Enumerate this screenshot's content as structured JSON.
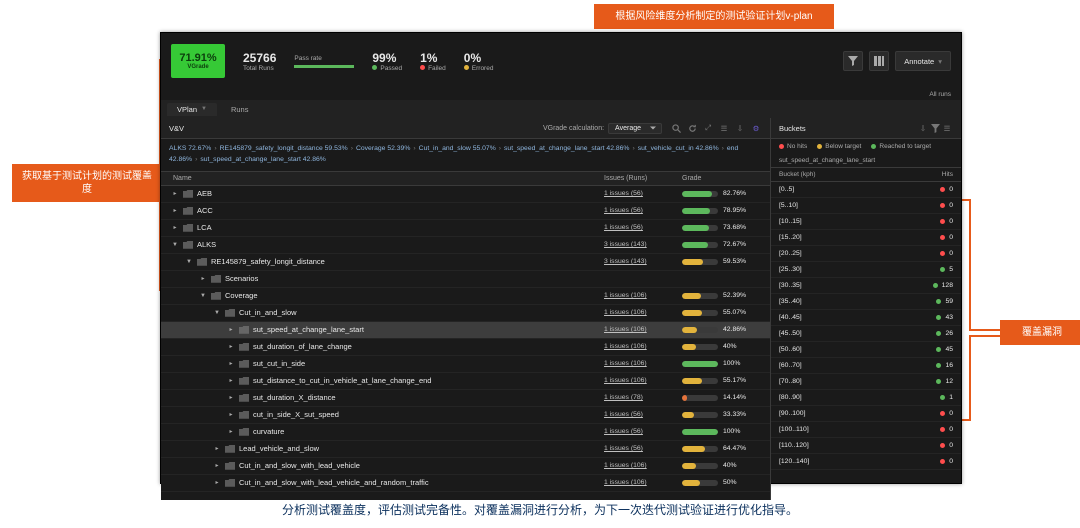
{
  "colors": {
    "green": "#5cb85c",
    "yellow": "#e2b33c",
    "orange": "#e6743c",
    "red": "#ff4d4d"
  },
  "callouts": {
    "top": "根据风险维度分析制定的测试验证计划v-plan",
    "left": "获取基于测试计划的测试覆盖度",
    "right": "覆盖漏洞"
  },
  "kpi": {
    "vgrade_value": "71.91%",
    "vgrade_label": "VGrade",
    "total_runs": "25766",
    "total_runs_label": "Total Runs",
    "pass_rate_label": "Pass rate",
    "passed_pct": "99%",
    "passed_label": "Passed",
    "failed_pct": "1%",
    "failed_label": "Failed",
    "errored_pct": "0%",
    "errored_label": "Errored",
    "annotate_label": "Annotate",
    "all_runs_label": "All runs"
  },
  "tabs": {
    "vplan": "VPlan",
    "runs": "Runs"
  },
  "vv": {
    "title": "V&V",
    "calc_label": "VGrade calculation:",
    "calc_value": "Average",
    "breadcrumbs": [
      "ALKS 72.67%",
      "RE145879_safety_longit_distance 59.53%",
      "Coverage 52.39%",
      "Cut_in_and_slow 55.07%",
      "sut_speed_at_change_lane_start 42.86%",
      "sut_vehicle_cut_in 42.86%",
      "end 42.86%",
      "sut_speed_at_change_lane_start 42.86%"
    ],
    "cols": {
      "name": "Name",
      "issues": "Issues (Runs)",
      "grade": "Grade"
    },
    "rows": [
      {
        "indent": 0,
        "caret": "right",
        "label": "AEB",
        "issues": "1 issues (56)",
        "pct": 82.76,
        "sel": false,
        "color": "green"
      },
      {
        "indent": 0,
        "caret": "right",
        "label": "ACC",
        "issues": "1 issues (56)",
        "pct": 78.95,
        "sel": false,
        "color": "green"
      },
      {
        "indent": 0,
        "caret": "right",
        "label": "LCA",
        "issues": "1 issues (56)",
        "pct": 73.68,
        "sel": false,
        "color": "green"
      },
      {
        "indent": 0,
        "caret": "down",
        "label": "ALKS",
        "issues": "3 issues (143)",
        "pct": 72.67,
        "sel": false,
        "color": "green"
      },
      {
        "indent": 1,
        "caret": "down",
        "label": "RE145879_safety_longit_distance",
        "issues": "3 issues (143)",
        "pct": 59.53,
        "sel": false,
        "color": "yellow"
      },
      {
        "indent": 2,
        "caret": "right",
        "label": "Scenarios",
        "issues": "",
        "pct": null,
        "sel": false
      },
      {
        "indent": 2,
        "caret": "down",
        "label": "Coverage",
        "issues": "1 issues (106)",
        "pct": 52.39,
        "sel": false,
        "color": "yellow"
      },
      {
        "indent": 3,
        "caret": "down",
        "label": "Cut_in_and_slow",
        "issues": "1 issues (106)",
        "pct": 55.07,
        "sel": false,
        "color": "yellow"
      },
      {
        "indent": 4,
        "caret": "right",
        "label": "sut_speed_at_change_lane_start",
        "issues": "1 issues (106)",
        "pct": 42.86,
        "sel": true,
        "color": "yellow"
      },
      {
        "indent": 4,
        "caret": "right",
        "label": "sut_duration_of_lane_change",
        "issues": "1 issues (106)",
        "pct": 40,
        "sel": false,
        "color": "yellow"
      },
      {
        "indent": 4,
        "caret": "right",
        "label": "sut_cut_in_side",
        "issues": "1 issues (106)",
        "pct": 100,
        "sel": false,
        "color": "green"
      },
      {
        "indent": 4,
        "caret": "right",
        "label": "sut_distance_to_cut_in_vehicle_at_lane_change_end",
        "issues": "1 issues (106)",
        "pct": 55.17,
        "sel": false,
        "color": "yellow"
      },
      {
        "indent": 4,
        "caret": "right",
        "label": "sut_duration_X_distance",
        "issues": "1 issues (78)",
        "pct": 14.14,
        "sel": false,
        "color": "orange"
      },
      {
        "indent": 4,
        "caret": "right",
        "label": "cut_in_side_X_sut_speed",
        "issues": "1 issues (56)",
        "pct": 33.33,
        "sel": false,
        "color": "yellow"
      },
      {
        "indent": 4,
        "caret": "right",
        "label": "curvature",
        "issues": "1 issues (56)",
        "pct": 100,
        "sel": false,
        "color": "green"
      },
      {
        "indent": 3,
        "caret": "right",
        "label": "Lead_vehicle_and_slow",
        "issues": "1 issues (56)",
        "pct": 64.47,
        "sel": false,
        "color": "yellow"
      },
      {
        "indent": 3,
        "caret": "right",
        "label": "Cut_in_and_slow_with_lead_vehicle",
        "issues": "1 issues (106)",
        "pct": 40,
        "sel": false,
        "color": "yellow"
      },
      {
        "indent": 3,
        "caret": "right",
        "label": "Cut_in_and_slow_with_lead_vehicle_and_random_traffic",
        "issues": "1 issues (106)",
        "pct": 50,
        "sel": false,
        "color": "yellow"
      }
    ]
  },
  "buckets": {
    "title": "Buckets",
    "legend": {
      "no_hits": "No hits",
      "below": "Below target",
      "reached": "Reached to target"
    },
    "subtitle": "sut_speed_at_change_lane_start",
    "cols": {
      "bucket": "Bucket (kph)",
      "hits": "Hits"
    },
    "rows": [
      {
        "label": "[0..5]",
        "hits": 0,
        "status": "red"
      },
      {
        "label": "[5..10]",
        "hits": 0,
        "status": "red"
      },
      {
        "label": "[10..15]",
        "hits": 0,
        "status": "red"
      },
      {
        "label": "[15..20]",
        "hits": 0,
        "status": "red"
      },
      {
        "label": "[20..25]",
        "hits": 0,
        "status": "red"
      },
      {
        "label": "[25..30]",
        "hits": 5,
        "status": "green"
      },
      {
        "label": "[30..35]",
        "hits": 128,
        "status": "green"
      },
      {
        "label": "[35..40]",
        "hits": 59,
        "status": "green"
      },
      {
        "label": "[40..45]",
        "hits": 43,
        "status": "green"
      },
      {
        "label": "[45..50]",
        "hits": 26,
        "status": "green"
      },
      {
        "label": "[50..60]",
        "hits": 45,
        "status": "green"
      },
      {
        "label": "[60..70]",
        "hits": 16,
        "status": "green"
      },
      {
        "label": "[70..80]",
        "hits": 12,
        "status": "green"
      },
      {
        "label": "[80..90]",
        "hits": 1,
        "status": "green"
      },
      {
        "label": "[90..100]",
        "hits": 0,
        "status": "red"
      },
      {
        "label": "[100..110]",
        "hits": 0,
        "status": "red"
      },
      {
        "label": "[110..120]",
        "hits": 0,
        "status": "red"
      },
      {
        "label": "[120..140]",
        "hits": 0,
        "status": "red"
      }
    ]
  },
  "footer": "分析测试覆盖度，评估测试完备性。对覆盖漏洞进行分析，为下一次迭代测试验证进行优化指导。",
  "chart_data": {
    "type": "table",
    "title": "V&V VGrade by item",
    "series": [
      {
        "name": "Grade %",
        "categories_key": "vv.rows[].label",
        "values_key": "vv.rows[].pct"
      }
    ],
    "buckets_histogram": {
      "type": "bar",
      "title": "sut_speed_at_change_lane_start hits per bucket (kph)",
      "categories": [
        "[0..5]",
        "[5..10]",
        "[10..15]",
        "[15..20]",
        "[20..25]",
        "[25..30]",
        "[30..35]",
        "[35..40]",
        "[40..45]",
        "[45..50]",
        "[50..60]",
        "[60..70]",
        "[70..80]",
        "[80..90]",
        "[90..100]",
        "[100..110]",
        "[110..120]",
        "[120..140]"
      ],
      "values": [
        0,
        0,
        0,
        0,
        0,
        5,
        128,
        59,
        43,
        26,
        45,
        16,
        12,
        1,
        0,
        0,
        0,
        0
      ]
    }
  }
}
